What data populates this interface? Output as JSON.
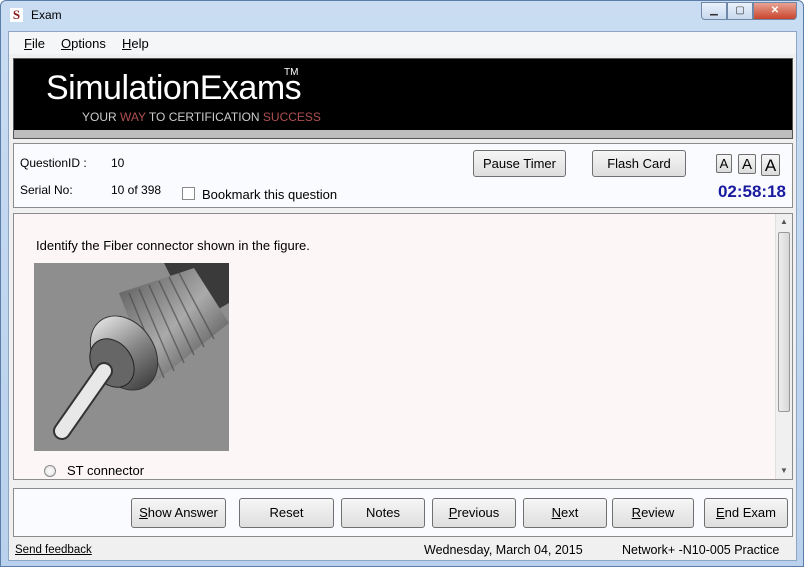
{
  "window": {
    "title": "Exam",
    "app_icon": "S",
    "controls": [
      "minimize",
      "maximize",
      "close"
    ]
  },
  "menu": [
    {
      "label": "File",
      "accel": "F"
    },
    {
      "label": "Options",
      "accel": "O"
    },
    {
      "label": "Help",
      "accel": "H"
    }
  ],
  "banner": {
    "logo": "SimulationExams",
    "tm": "TM",
    "tagline": {
      "part1": "YOUR ",
      "part2": "WAY",
      "part3": " TO CERTIFICATION ",
      "part4": "SUCCESS"
    }
  },
  "info": {
    "question_id_label": "QuestionID :",
    "question_id": "10",
    "serial_label": "Serial No:",
    "serial": "10 of 398",
    "bookmark_label": "Bookmark this question",
    "bookmark_checked": false,
    "pause_timer": "Pause Timer",
    "flash_card": "Flash Card",
    "font_sizes": [
      "A",
      "A",
      "A"
    ],
    "timer": "02:58:18"
  },
  "question": {
    "text": "Identify the Fiber connector shown in the figure.",
    "options": [
      {
        "label": "ST connector",
        "selected": false
      }
    ]
  },
  "buttons": [
    "Show Answer",
    "Reset",
    "Notes",
    "Previous",
    "Next",
    "Review",
    "End Exam"
  ],
  "status": {
    "feedback": "Send feedback",
    "date": "Wednesday, March 04, 2015",
    "exam": "Network+ -N10-005 Practice"
  },
  "colors": {
    "timer": "#1a1aa0",
    "tagline_accent": "#b05050",
    "question_bg": "#fdf6f6"
  }
}
